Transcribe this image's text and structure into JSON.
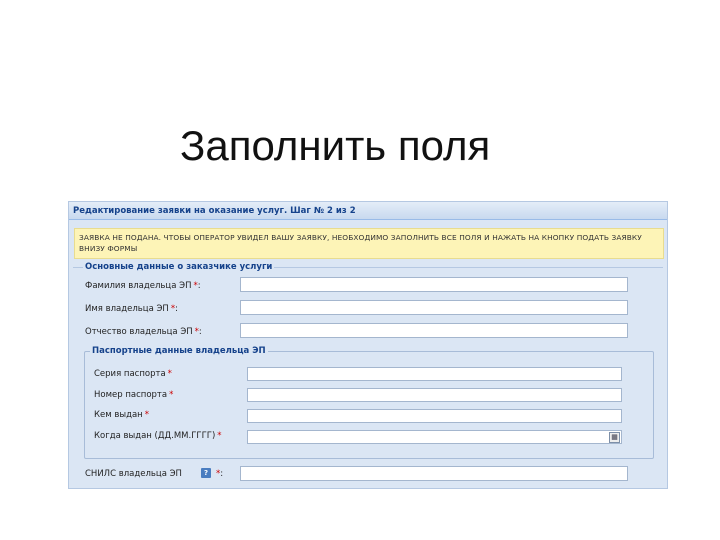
{
  "slide": {
    "title": "Заполнить поля"
  },
  "form": {
    "header": "Редактирование заявки на оказание услуг. Шаг № 2 из 2",
    "notice": "ЗАЯВКА НЕ ПОДАНА. ЧТОБЫ ОПЕРАТОР УВИДЕЛ ВАШУ ЗАЯВКУ, НЕОБХОДИМО ЗАПОЛНИТЬ ВСЕ ПОЛЯ И НАЖАТЬ НА КНОПКУ ПОДАТЬ ЗАЯВКУ ВНИЗУ ФОРМЫ",
    "section_customer": "Основные данные о заказчике услуги",
    "required_mark": "*",
    "fields": {
      "last_name": "Фамилия владельца ЭП",
      "first_name": "Имя владельца ЭП",
      "middle_name": "Отчество владельца ЭП",
      "snils": "СНИЛС владельца ЭП"
    },
    "passport": {
      "legend": "Паспортные данные владельца ЭП",
      "series": "Серия паспорта",
      "number": "Номер паспорта",
      "issued_by": "Кем выдан",
      "issued_date": "Когда выдан (ДД.ММ.ГГГГ)"
    },
    "colors": {
      "panel_bg": "#dbe6f4",
      "notice_bg": "#fdf4b7",
      "header_text": "#15428b",
      "required": "#cc0000"
    },
    "icons": {
      "date_picker": "calendar-icon",
      "help": "question-icon"
    }
  }
}
